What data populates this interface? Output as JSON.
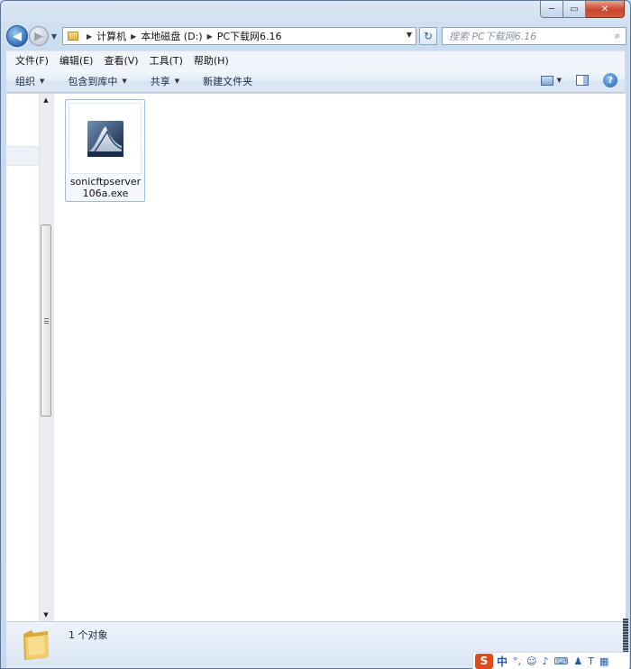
{
  "window": {
    "caption": {
      "minimize": "─",
      "maximize": "▭",
      "close": "✕"
    }
  },
  "nav": {
    "back": "◀",
    "forward": "▶",
    "history_arrow": "▼",
    "breadcrumb": [
      "计算机",
      "本地磁盘 (D:)",
      "PC下载网6.16"
    ],
    "address_dropdown": "▼",
    "refresh": "↻",
    "search_placeholder": "搜索 PC下载网6.16",
    "search_icon": "⌕"
  },
  "menubar": {
    "items": [
      "文件(F)",
      "编辑(E)",
      "查看(V)",
      "工具(T)",
      "帮助(H)"
    ]
  },
  "commandbar": {
    "organize": "组织",
    "include_library": "包含到库中",
    "share": "共享",
    "new_folder": "新建文件夹",
    "dropdown_arrow": "▼",
    "help": "?"
  },
  "scrollbar": {
    "up": "▲",
    "down": "▼"
  },
  "files": [
    {
      "name": "sonicftpserver106a.exe",
      "icon": "sonicftp-exe-icon"
    }
  ],
  "status": {
    "count_text": "1 个对象"
  },
  "ime": {
    "logo": "S",
    "mode": "中",
    "punct": "°,",
    "emoji": "☺",
    "mic": "♪",
    "keyboard": "⌨",
    "user": "♟",
    "shirt": "T",
    "grid": "▦"
  },
  "colors": {
    "window_frame": "#c5d8ee",
    "accent_blue": "#2f6fb8",
    "close_red": "#c7452d",
    "ime_orange": "#e24b1c"
  }
}
